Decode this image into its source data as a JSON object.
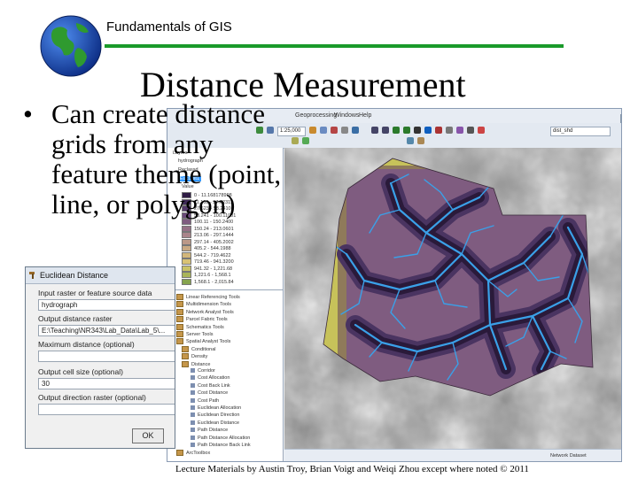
{
  "header": {
    "course_title": "Fundamentals of GIS",
    "colors": {
      "rule": "#1a9a2a"
    }
  },
  "slide": {
    "title": "Distance Measurement",
    "bullet_symbol": "•",
    "bullet_text": "Can create distance grids from any feature theme (point, line, or polygon)"
  },
  "arcmap": {
    "menu": [
      "Geoprocessing",
      "Windows",
      "Help"
    ],
    "scale_value": "1:25,000",
    "layer_combo": "dist_shd",
    "toc_layers": [
      "Layers",
      "hydrograph",
      "Reclassd",
      "EucDist1",
      "Value"
    ],
    "legend_entries": [
      "0 - 11.168178998",
      "11.168 - 27.62311",
      "27.623 - 58.24101",
      "58.241 - 100.11001",
      "100.11 - 150.2400",
      "150.24 - 213.0601",
      "213.06 - 297.1444",
      "297.14 - 405.2002",
      "405.2 - 544.1988",
      "544.2 - 719.4622",
      "719.46 - 941.3200",
      "941.32 - 1,221.68",
      "1,221.6 - 1,568.1",
      "1,568.1 - 2,015.84"
    ],
    "legend_colors": [
      "#2f1c44",
      "#3f2a58",
      "#53396a",
      "#6a4a78",
      "#7f5c80",
      "#957086",
      "#a9848a",
      "#bb9888",
      "#c8a882",
      "#d2b67a",
      "#d9c274",
      "#c9c266",
      "#a9b45a",
      "#86a44e"
    ],
    "toolbox_items": [
      "Linear Referencing Tools",
      "Multidimension Tools",
      "Network Analyst Tools",
      "Parcel Fabric Tools",
      "Schematics Tools",
      "Server Tools",
      "Spatial Analyst Tools",
      "Conditional",
      "Density",
      "Distance",
      "Corridor",
      "Cost Allocation",
      "Cost Back Link",
      "Cost Distance",
      "Cost Path",
      "Euclidean Allocation",
      "Euclidean Direction",
      "Euclidean Distance",
      "Path Distance",
      "Path Distance Allocation",
      "Path Distance Back Link",
      "ArcToolbox"
    ],
    "status_text": "Network Dataset"
  },
  "dialog": {
    "title": "Euclidean Distance",
    "label_input": "Input raster or feature source data",
    "value_input": "hydrograph",
    "label_output": "Output distance raster",
    "value_output": "E:\\Teaching\\NR343\\Lab_Data\\Lab_5\\...",
    "label_max": "Maximum distance (optional)",
    "label_cell": "Output cell size (optional)",
    "value_cell": "30",
    "label_direction": "Output direction raster (optional)",
    "ok_label": "OK"
  },
  "footer": {
    "text": "Lecture Materials by Austin Troy, Brian Voigt and Weiqi Zhou except where noted © 2011"
  }
}
